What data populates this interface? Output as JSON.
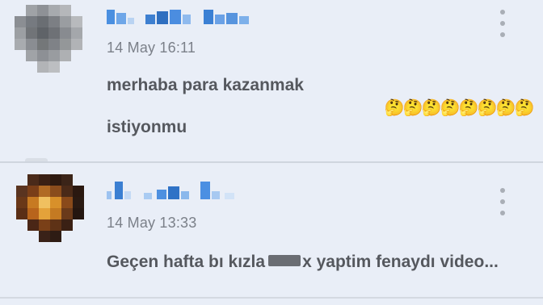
{
  "comments": [
    {
      "timestamp": "14 May 16:11",
      "lines": [
        "merhaba para kazanmak",
        "istiyonmu"
      ],
      "emojis": [
        "🤔",
        "🤔",
        "🤔",
        "🤔",
        "🤔",
        "🤔",
        "🤔",
        "🤔"
      ],
      "avatar_style": "pixelated-gray",
      "username_style": "pixelated-blue"
    },
    {
      "timestamp": "14 May 13:33",
      "text_before_censor": "Geçen hafta bı kızla",
      "text_after_censor": "x yaptim fenaydı video...",
      "avatar_style": "pixelated-orange",
      "username_style": "pixelated-blue"
    }
  ],
  "icons": {
    "menu": "more-vertical-icon",
    "emoji": "thinking-face-emoji"
  },
  "colors": {
    "background": "#e9eef7",
    "text": "#55585e",
    "timestamp": "#7b8089",
    "username_blur": "#3f86d8",
    "divider": "#cfd5de"
  }
}
